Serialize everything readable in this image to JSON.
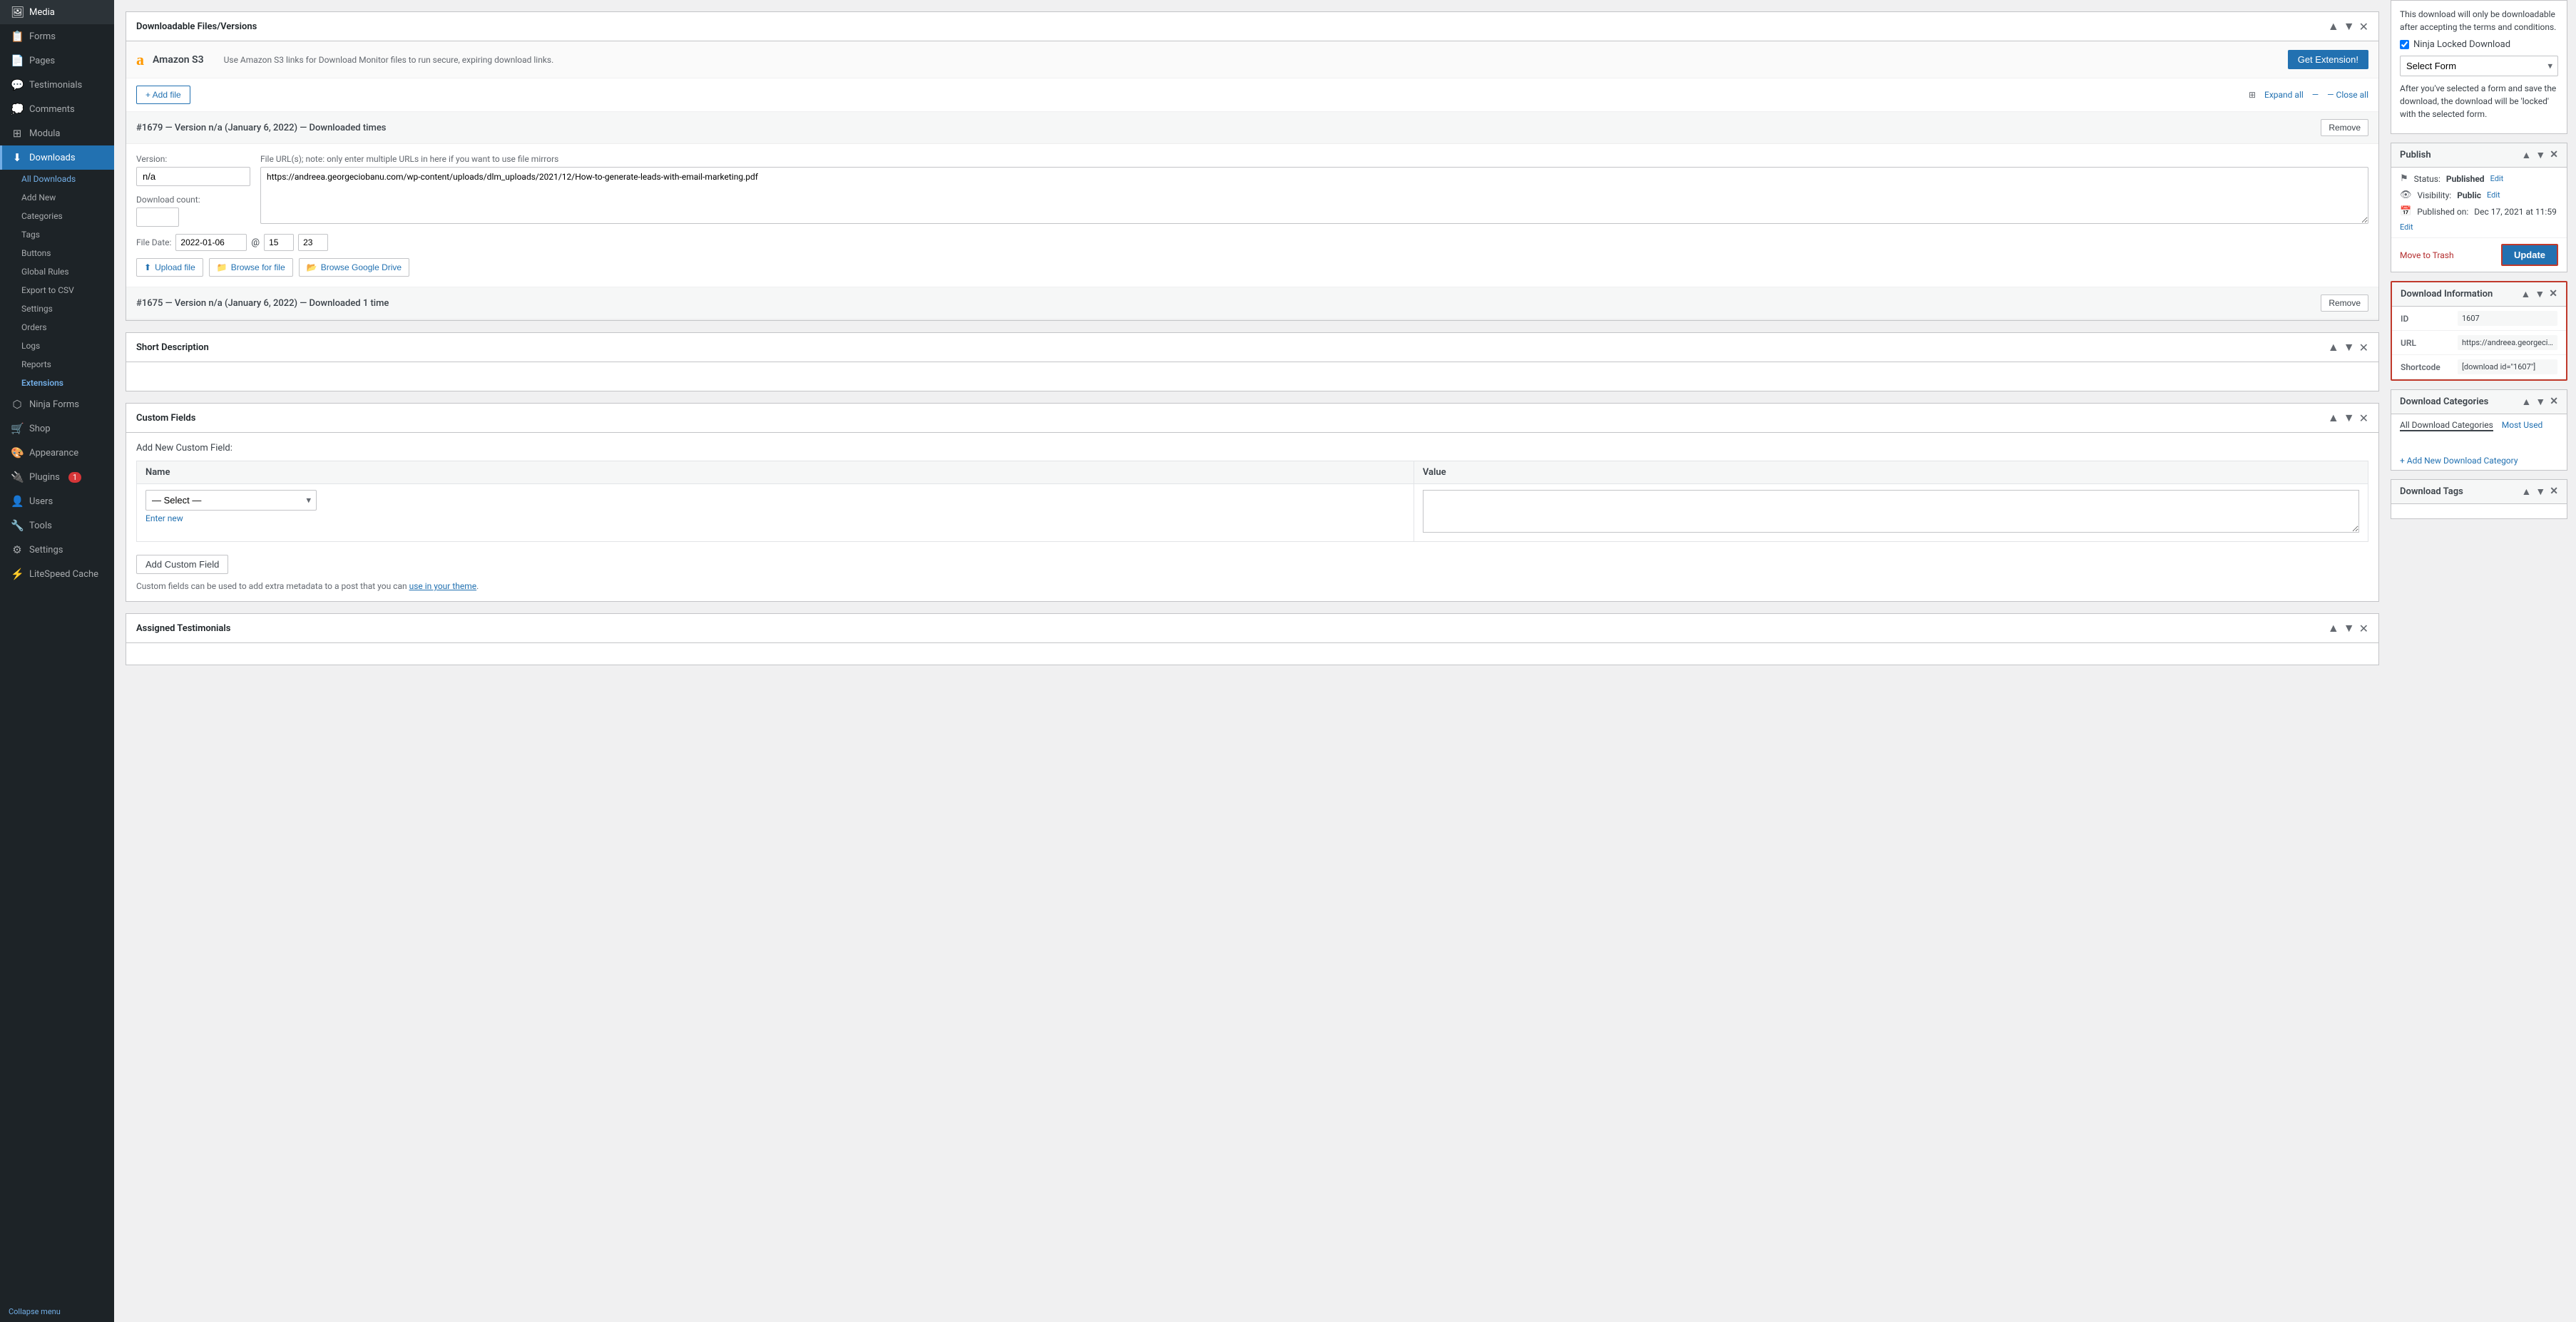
{
  "sidebar": {
    "items": [
      {
        "id": "media",
        "label": "Media",
        "icon": "🖼"
      },
      {
        "id": "forms",
        "label": "Forms",
        "icon": "📋"
      },
      {
        "id": "pages",
        "label": "Pages",
        "icon": "📄"
      },
      {
        "id": "testimonials",
        "label": "Testimonials",
        "icon": "💬"
      },
      {
        "id": "comments",
        "label": "Comments",
        "icon": "💭"
      },
      {
        "id": "modula",
        "label": "Modula",
        "icon": "⊞"
      },
      {
        "id": "downloads",
        "label": "Downloads",
        "icon": "⬇",
        "active": true
      },
      {
        "id": "appearance",
        "label": "Appearance",
        "icon": "🎨"
      },
      {
        "id": "plugins",
        "label": "Plugins",
        "icon": "🔌",
        "badge": "1"
      },
      {
        "id": "users",
        "label": "Users",
        "icon": "👤"
      },
      {
        "id": "tools",
        "label": "Tools",
        "icon": "🔧"
      },
      {
        "id": "settings",
        "label": "Settings",
        "icon": "⚙"
      },
      {
        "id": "litespeed",
        "label": "LiteSpeed Cache",
        "icon": "⚡"
      }
    ],
    "downloads_subitems": [
      {
        "id": "all-downloads",
        "label": "All Downloads",
        "active": true
      },
      {
        "id": "add-new",
        "label": "Add New"
      },
      {
        "id": "categories",
        "label": "Categories"
      },
      {
        "id": "tags",
        "label": "Tags"
      },
      {
        "id": "buttons",
        "label": "Buttons"
      },
      {
        "id": "global-rules",
        "label": "Global Rules"
      },
      {
        "id": "export-csv",
        "label": "Export to CSV"
      },
      {
        "id": "settings-sub",
        "label": "Settings"
      },
      {
        "id": "orders",
        "label": "Orders"
      },
      {
        "id": "logs",
        "label": "Logs"
      },
      {
        "id": "reports",
        "label": "Reports"
      },
      {
        "id": "extensions",
        "label": "Extensions",
        "highlight": true
      }
    ],
    "collapse_label": "Collapse menu"
  },
  "main": {
    "downloadable_files_panel": {
      "title": "Downloadable Files/Versions",
      "amazon_s3": {
        "name": "Amazon S3",
        "description": "Use Amazon S3 links for Download Monitor files to run secure, expiring download links.",
        "button_label": "Get Extension!"
      },
      "add_file_label": "+ Add file",
      "expand_label": "Expand all",
      "close_label": "— Close all",
      "version_1": {
        "header": "#1679 — Version n/a (January 6, 2022) — Downloaded times",
        "remove_label": "Remove",
        "version_label": "Version:",
        "version_value": "n/a",
        "url_label": "File URL(s); note: only enter multiple URLs in here if you want to use file mirrors",
        "url_value": "https://andreea.georgeciobanu.com/wp-content/uploads/dlm_uploads/2021/12/How-to-generate-leads-with-email-marketing.pdf",
        "download_count_label": "Download count:",
        "download_count_value": "",
        "file_date_label": "File Date:",
        "file_date_value": "2022-01-06",
        "file_time_h": "15",
        "file_time_m": "23",
        "upload_label": "Upload file",
        "browse_label": "Browse for file",
        "browse_gdrive_label": "Browse Google Drive"
      },
      "version_2": {
        "header": "#1675 — Version n/a (January 6, 2022) — Downloaded 1 time",
        "remove_label": "Remove"
      }
    },
    "short_description_panel": {
      "title": "Short Description"
    },
    "custom_fields_panel": {
      "title": "Custom Fields",
      "add_label": "Add New Custom Field:",
      "name_col": "Name",
      "value_col": "Value",
      "select_placeholder": "— Select —",
      "enter_new_label": "Enter new",
      "add_button_label": "Add Custom Field",
      "note": "Custom fields can be used to add extra metadata to a post that you can",
      "note_link": "use in your theme",
      "note_suffix": "."
    },
    "assigned_testimonials_panel": {
      "title": "Assigned Testimonials"
    }
  },
  "right": {
    "ninja_forms_panel": {
      "note": "This download will only be downloadable after accepting the terms and conditions.",
      "checkbox_label": "Ninja Locked Download",
      "checked": true,
      "select_form_label": "Select Form",
      "select_options": [
        "Select Form"
      ],
      "after_note": "After you've selected a form and save the download, the download will be 'locked' with the selected form."
    },
    "publish_panel": {
      "title": "Publish",
      "status_label": "Status:",
      "status_value": "Published",
      "status_edit": "Edit",
      "visibility_label": "Visibility:",
      "visibility_value": "Public",
      "visibility_edit": "Edit",
      "published_label": "Published on:",
      "published_value": "Dec 17, 2021 at 11:59",
      "published_edit": "Edit",
      "move_to_trash": "Move to Trash",
      "update_label": "Update"
    },
    "download_info_panel": {
      "title": "Download Information",
      "id_label": "ID",
      "id_value": "1607",
      "url_label": "URL",
      "url_value": "https://andreea.georgeciobanu",
      "shortcode_label": "Shortcode",
      "shortcode_value": "[download id=\"1607\"]"
    },
    "download_categories_panel": {
      "title": "Download Categories",
      "all_label": "All Download Categories",
      "most_used_label": "Most Used",
      "add_label": "+ Add New Download Category"
    },
    "download_tags_panel": {
      "title": "Download Tags"
    }
  }
}
